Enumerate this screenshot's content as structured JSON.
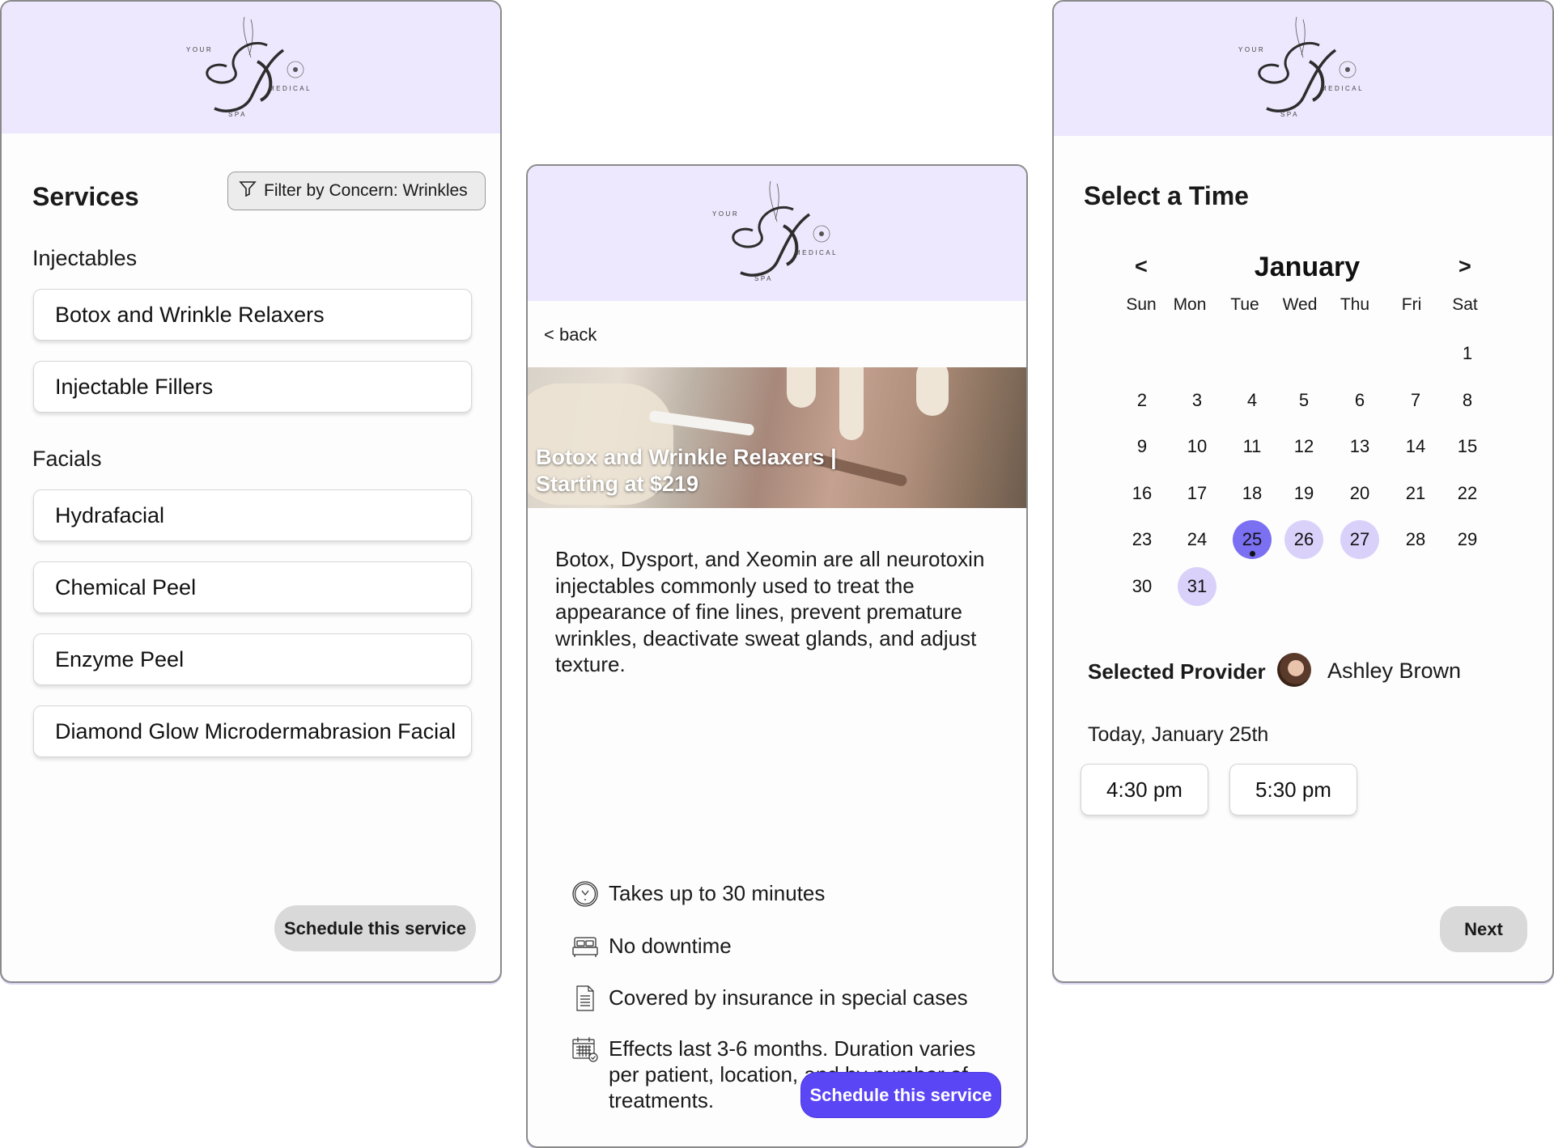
{
  "brand": {
    "logo_words": {
      "top": "YOUR",
      "right": "MEDICAL",
      "bottom": "SPA"
    },
    "header_color": "#ede8fd"
  },
  "services_screen": {
    "title": "Services",
    "filter_button": {
      "icon": "filter-icon",
      "label": "Filter by Concern: Wrinkles"
    },
    "categories": [
      {
        "label": "Injectables",
        "items": [
          "Botox and Wrinkle Relaxers",
          "Injectable Fillers"
        ]
      },
      {
        "label": "Facials",
        "items": [
          "Hydrafacial",
          "Chemical Peel",
          "Enzyme Peel",
          "Diamond Glow Microdermabrasion Facial"
        ]
      }
    ],
    "schedule_button": "Schedule this service"
  },
  "detail_screen": {
    "back_label": "< back",
    "hero_title": "Botox and Wrinkle Relaxers | Starting at $219",
    "description": "Botox, Dysport, and Xeomin are all neurotoxin injectables commonly used to treat the appearance of fine lines, prevent premature wrinkles, deactivate sweat glands, and adjust texture.",
    "features": [
      {
        "icon": "clock-icon",
        "text": "Takes up to 30 minutes"
      },
      {
        "icon": "bed-icon",
        "text": "No downtime"
      },
      {
        "icon": "document-icon",
        "text": "Covered by insurance in special cases"
      },
      {
        "icon": "calendar-check-icon",
        "text": "Effects last 3-6 months. Duration varies per patient, location, and by number of treatments."
      }
    ],
    "schedule_button": "Schedule this service",
    "accent_color": "#5b46f5"
  },
  "time_screen": {
    "title": "Select a Time",
    "calendar": {
      "prev_label": "<",
      "next_label": ">",
      "month": "January",
      "weekdays": [
        "Sun",
        "Mon",
        "Tue",
        "Wed",
        "Thu",
        "Fri",
        "Sat"
      ],
      "first_weekday_index": 6,
      "days_in_month": 31,
      "selected_day": 25,
      "today": 25,
      "available_days": [
        26,
        27,
        31
      ],
      "selected_color": "#7b6ff2",
      "available_color": "#d9d1fa"
    },
    "provider_label": "Selected Provider",
    "provider_name": "Ashley Brown",
    "date_heading": "Today, January 25th",
    "time_slots": [
      "4:30 pm",
      "5:30 pm"
    ],
    "next_button": "Next"
  }
}
